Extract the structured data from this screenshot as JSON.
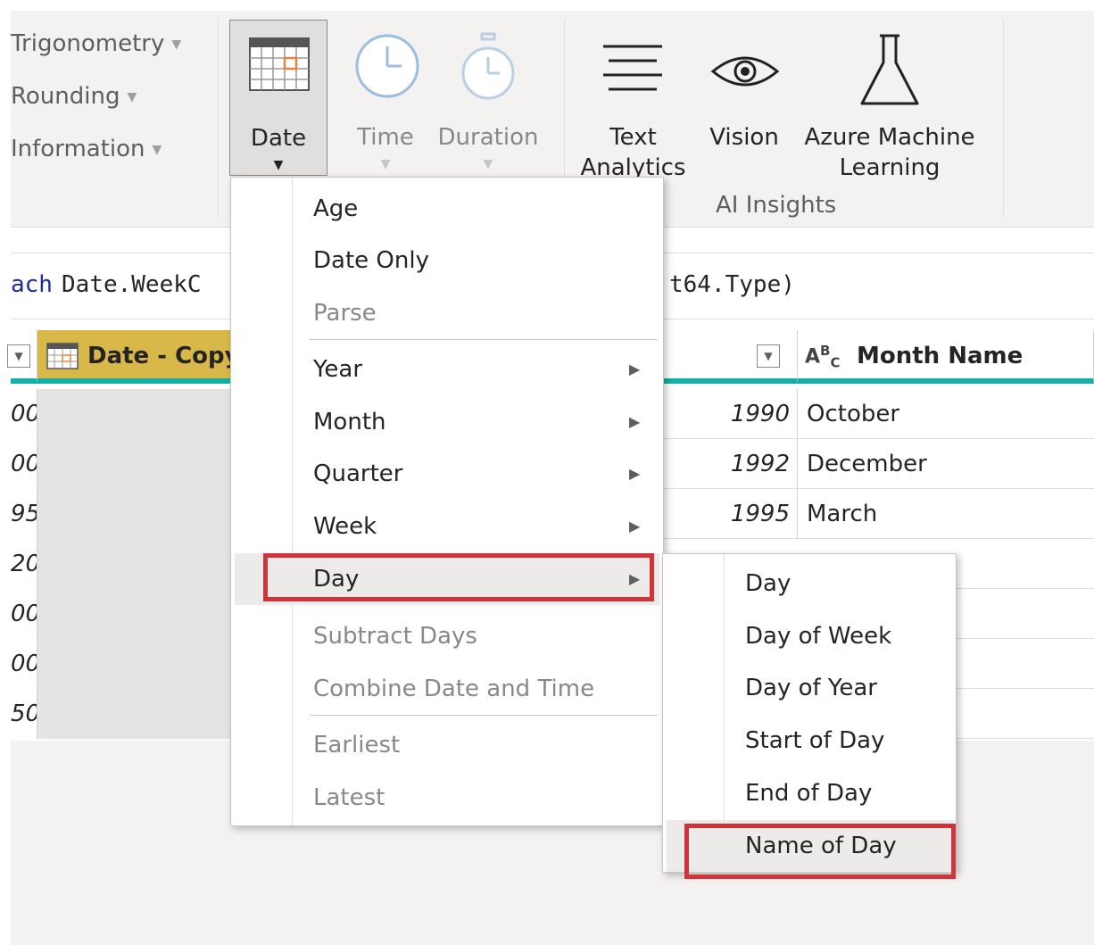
{
  "ribbon": {
    "dropdowns": [
      "Trigonometry",
      "Rounding",
      "Information"
    ],
    "date_label": "Date",
    "time_label": "Time",
    "duration_label": "Duration",
    "text_analytics_label_1": "Text",
    "text_analytics_label_2": "Analytics",
    "vision_label": "Vision",
    "azure_label_1": "Azure Machine",
    "azure_label_2": "Learning",
    "group_label": "AI Insights"
  },
  "formula": {
    "left_keyword": "each",
    "left_visible": "ach",
    "left_rest": " Date.WeekC",
    "right_rest": "t64.Type)"
  },
  "grid": {
    "headers": {
      "date_copy": "Date - Copy",
      "month_name": "Month Name",
      "text_type_icon": "ABC"
    },
    "rows": [
      {
        "first": "00",
        "year": "1990",
        "month": "October"
      },
      {
        "first": "00",
        "year": "1992",
        "month": "December"
      },
      {
        "first": "95",
        "year": "1995",
        "month": "March"
      },
      {
        "first": "20",
        "year": "",
        "month": ""
      },
      {
        "first": "00",
        "year": "",
        "month": ""
      },
      {
        "first": "00",
        "year": "",
        "month": ""
      },
      {
        "first": "50",
        "year": "",
        "month": ""
      }
    ]
  },
  "date_menu": {
    "items": [
      {
        "label": "Age",
        "disabled": false
      },
      {
        "label": "Date Only",
        "disabled": false
      },
      {
        "label": "Parse",
        "disabled": true
      },
      {
        "label": "Year",
        "disabled": false,
        "submenu": true
      },
      {
        "label": "Month",
        "disabled": false,
        "submenu": true
      },
      {
        "label": "Quarter",
        "disabled": false,
        "submenu": true
      },
      {
        "label": "Week",
        "disabled": false,
        "submenu": true
      },
      {
        "label": "Day",
        "disabled": false,
        "submenu": true,
        "active": true
      },
      {
        "label": "Subtract Days",
        "disabled": true
      },
      {
        "label": "Combine Date and Time",
        "disabled": true
      },
      {
        "label": "Earliest",
        "disabled": true
      },
      {
        "label": "Latest",
        "disabled": true
      }
    ]
  },
  "day_submenu": {
    "items": [
      "Day",
      "Day of Week",
      "Day of Year",
      "Start of Day",
      "End of Day",
      "Name of Day"
    ],
    "highlighted": "Name of Day"
  },
  "colors": {
    "highlight_border": "#d13438",
    "accent_teal": "#14b0a6",
    "date_header": "#d9b84a"
  }
}
